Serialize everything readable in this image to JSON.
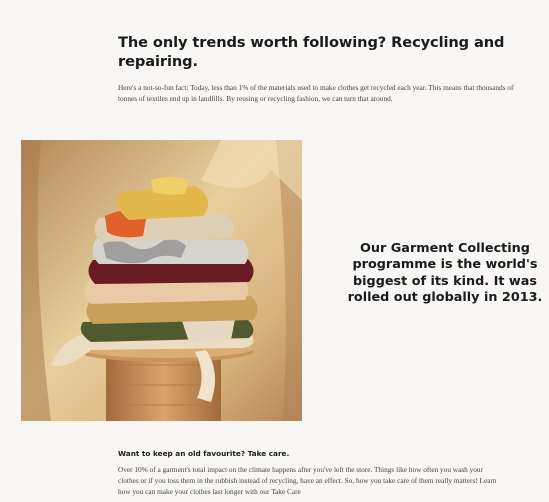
{
  "intro": {
    "heading": "The only trends worth following? Recycling and repairing.",
    "body": "Here's a not-so-fun fact: Today, less than 1% of the materials used to make clothes get recycled each year. This means that thousands of tonnes of textiles end up in landfills. By reusing or recycling fashion, we can turn that around."
  },
  "photo": {
    "icon": "stacked-clothes-photo",
    "colors": {
      "background": "#c9a676",
      "stool": "#c9945a",
      "yellow": "#e2b84a",
      "orange": "#e0602a",
      "burgundy": "#6a1c24",
      "olive": "#4f5a2e",
      "cream": "#ecdcc2"
    }
  },
  "callout": {
    "text": "Our Garment Collecting programme is the world's biggest of its kind. It was rolled out globally in 2013."
  },
  "care": {
    "heading": "Want to keep an old favourite? Take care.",
    "body": "Over 10% of a garment's total impact on the climate happens after you've left the store. Things like how often you wash your clothes or if you toss them in the rubbish instead of recycling, have an effect. So, how you take care of them really matters! Learn how you can make your clothes last longer with our Take Care"
  }
}
